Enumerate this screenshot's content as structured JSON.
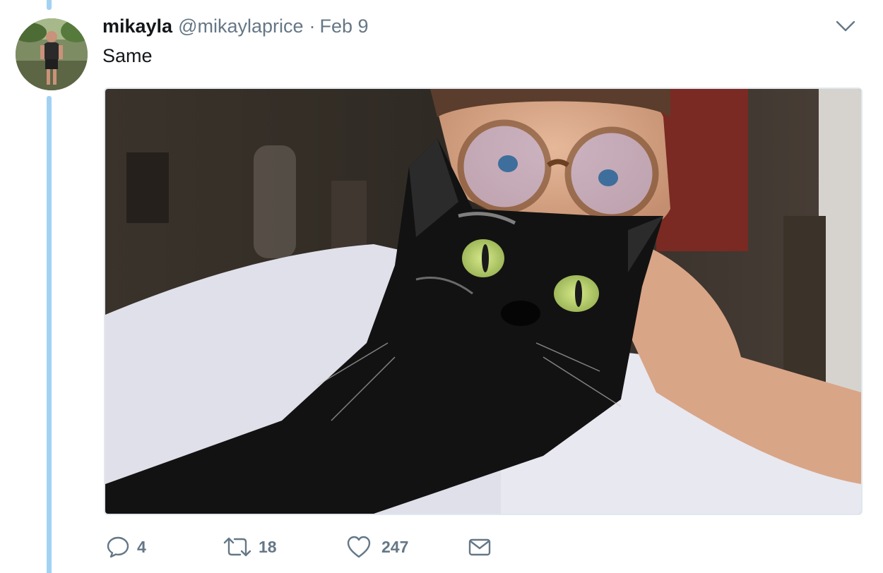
{
  "tweet": {
    "display_name": "mikayla",
    "username": "@mikaylaprice",
    "separator": "·",
    "date": "Feb 9",
    "text": "Same"
  },
  "icons": {
    "menu": "chevron-down-icon",
    "reply": "speech-bubble-icon",
    "retweet": "retweet-arrows-icon",
    "like": "heart-icon",
    "dm": "envelope-icon"
  },
  "actions": {
    "reply_count": "4",
    "retweet_count": "18",
    "like_count": "247"
  },
  "colors": {
    "thread_line": "#a2d2f2",
    "secondary_text": "#657786",
    "primary_text": "#14171a"
  }
}
